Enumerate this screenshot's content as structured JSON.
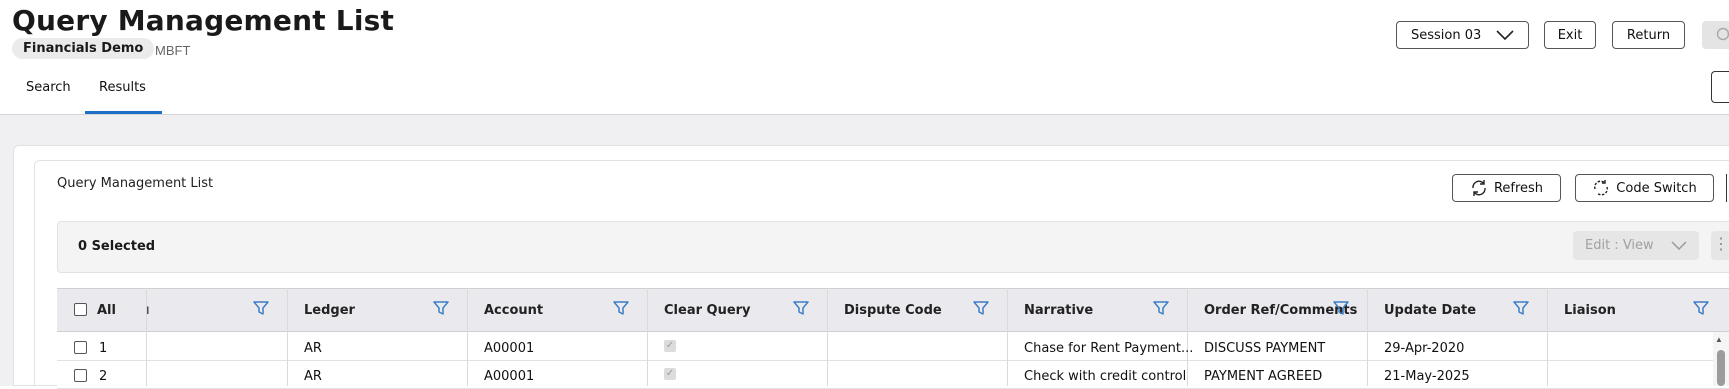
{
  "header": {
    "title": "Query Management List",
    "company": "Financials Demo",
    "company_code": "MBFT",
    "session_label": "Session 03",
    "exit_label": "Exit",
    "return_label": "Return"
  },
  "tabs": [
    {
      "label": "Search",
      "active": false
    },
    {
      "label": "Results",
      "active": true
    }
  ],
  "panel": {
    "title": "Query Management List",
    "refresh_label": "Refresh",
    "code_switch_label": "Code Switch",
    "selected_text": "0 Selected",
    "edit_view_label": "Edit : View",
    "more_glyph": "⋮"
  },
  "table": {
    "select_all_label": "All",
    "truncated_header": "ı",
    "columns": [
      "Ledger",
      "Account",
      "Clear Query",
      "Dispute Code",
      "Narrative",
      "Order Ref/Comments",
      "Update Date",
      "Liaison"
    ],
    "rows": [
      {
        "num": "1",
        "ledger": "AR",
        "account": "A00001",
        "clear_query": true,
        "dispute_code": "",
        "narrative": "Chase for Rent Payment...",
        "order_ref": "DISCUSS PAYMENT",
        "update_date": "29-Apr-2020",
        "liaison": ""
      },
      {
        "num": "2",
        "ledger": "AR",
        "account": "A00001",
        "clear_query": true,
        "dispute_code": "",
        "narrative": "Check with credit control",
        "order_ref": "PAYMENT AGREED",
        "update_date": "21-May-2025",
        "liaison": ""
      }
    ]
  },
  "colors": {
    "accent": "#1e6fc6",
    "filter_icon": "#3d7fc4"
  },
  "icons": [
    "chevron-down-icon",
    "refresh-icon",
    "code-switch-icon",
    "filter-icon",
    "kebab-menu-icon",
    "search-icon"
  ]
}
